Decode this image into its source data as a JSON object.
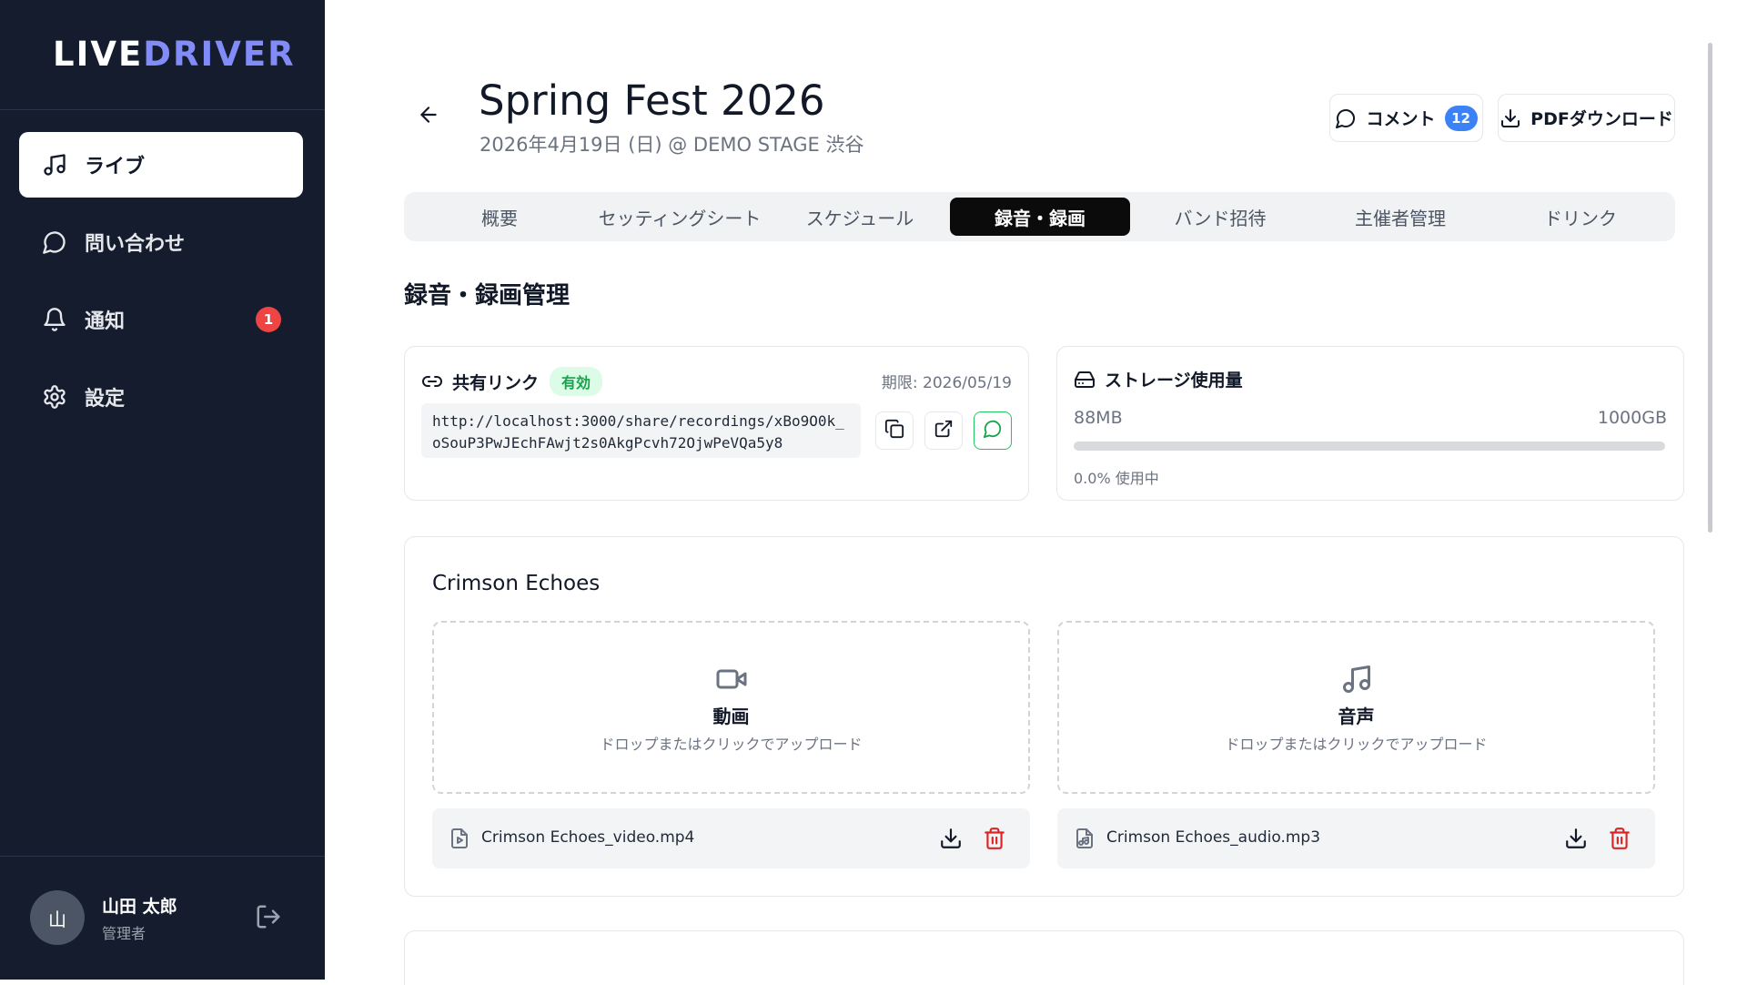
{
  "app": {
    "logo_main": "LIVE",
    "logo_accent": "DRIVER"
  },
  "sidebar": {
    "items": [
      {
        "label": "ライブ",
        "icon": "music-note-icon",
        "active": true
      },
      {
        "label": "問い合わせ",
        "icon": "chat-bubble-icon"
      },
      {
        "label": "通知",
        "icon": "bell-icon",
        "badge": "1"
      },
      {
        "label": "設定",
        "icon": "gear-icon"
      }
    ],
    "user": {
      "avatar": "山",
      "name": "山田 太郎",
      "role": "管理者"
    }
  },
  "header": {
    "title": "Spring Fest 2026",
    "subtitle": "2026年4月19日 (日) @ DEMO STAGE 渋谷",
    "comment_label": "コメント",
    "comment_count": "12",
    "pdf_label": "PDFダウンロード"
  },
  "tabs": [
    {
      "label": "概要"
    },
    {
      "label": "セッティングシート"
    },
    {
      "label": "スケジュール"
    },
    {
      "label": "録音・録画",
      "active": true
    },
    {
      "label": "バンド招待"
    },
    {
      "label": "主催者管理"
    },
    {
      "label": "ドリンク"
    }
  ],
  "section_title": "録音・録画管理",
  "share": {
    "title": "共有リンク",
    "status": "有効",
    "expiry": "期限: 2026/05/19",
    "url": "http://localhost:3000/share/recordings/xBo9O0k_oSouP3PwJEchFAwjt2s0AkgPcvh72OjwPeVQa5y8"
  },
  "storage": {
    "title": "ストレージ使用量",
    "used": "88MB",
    "total": "1000GB",
    "percent_text": "0.0% 使用中",
    "percent": 0.0
  },
  "band": {
    "name": "Crimson Echoes",
    "video": {
      "title": "動画",
      "hint": "ドロップまたはクリックでアップロード",
      "file": "Crimson Echoes_video.mp4"
    },
    "audio": {
      "title": "音声",
      "hint": "ドロップまたはクリックでアップロード",
      "file": "Crimson Echoes_audio.mp3"
    }
  },
  "colors": {
    "sidebar_bg": "#141c2e",
    "accent": "#818cf8",
    "badge_red": "#ef4444",
    "badge_blue": "#3b82f6",
    "valid_green": "#16a34a",
    "delete_red": "#dc2626"
  }
}
